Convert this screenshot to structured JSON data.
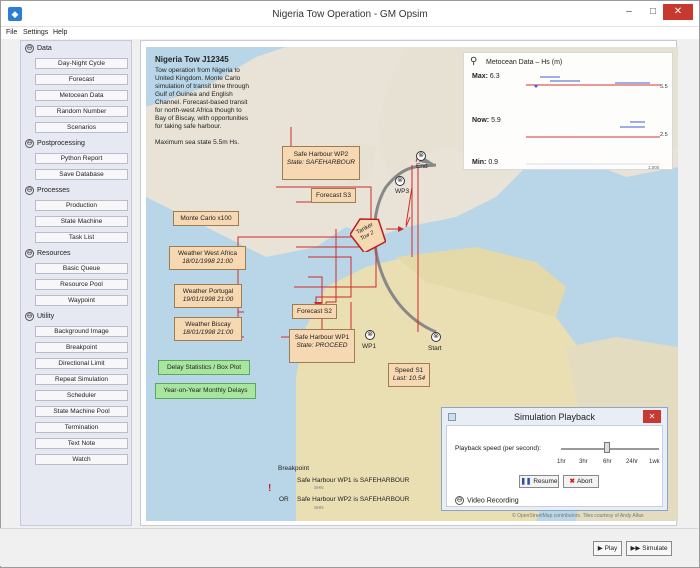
{
  "window": {
    "title": "Nigeria Tow Operation - GM Opsim",
    "app_icon": "app-icon",
    "min_symbol": "–",
    "max_symbol": "□",
    "close_symbol": "✕"
  },
  "menu": [
    "File",
    "Settings",
    "Help"
  ],
  "sidebar": {
    "sections": [
      {
        "label": "Data",
        "toggle": "⊖",
        "items": [
          "Day-Night Cycle",
          "Forecast",
          "Metocean Data",
          "Random Number",
          "Scenarios"
        ]
      },
      {
        "label": "Postprocessing",
        "toggle": "⊖",
        "items": [
          "Python Report",
          "Save Database"
        ]
      },
      {
        "label": "Processes",
        "toggle": "⊖",
        "items": [
          "Production",
          "State Machine",
          "Task List"
        ]
      },
      {
        "label": "Resources",
        "toggle": "⊖",
        "items": [
          "Basic Queue",
          "Resource Pool",
          "Waypoint"
        ]
      },
      {
        "label": "Utility",
        "toggle": "⊖",
        "items": [
          "Background Image",
          "Breakpoint",
          "Directional Limit",
          "Repeat Simulation",
          "Scheduler",
          "State Machine Pool",
          "Termination",
          "Text Note",
          "Watch"
        ]
      }
    ]
  },
  "info": {
    "title": "Nigeria Tow J12345",
    "description": "Tow operation from Nigeria to United Kingdom. Monte Carlo simulation of transit time through Gulf of Guinea and English Channel. Forecast-based transit for north-west Africa though to Bay of Biscay, with opportunities for taking safe harbour.",
    "max_sea_state": "Maximum sea state 5.5m Hs."
  },
  "boxes": {
    "safe_harbour_wp2": {
      "title": "Safe Harbour WP2",
      "status": "State: SAFEHARBOUR"
    },
    "forecast_s3": "Forecast S3",
    "monte_carlo": "Monte Carlo x100",
    "weather_west_africa": {
      "title": "Weather West Africa",
      "date": "18/01/1998 21:00"
    },
    "weather_portugal": {
      "title": "Weather Portugal",
      "date": "19/01/1998 21:00"
    },
    "weather_biscay": {
      "title": "Weather Biscay",
      "date": "18/01/1998 21:00"
    },
    "forecast_s2": "Forecast S2",
    "safe_harbour_wp1": {
      "title": "Safe Harbour WP1",
      "status": "State: PROCEED"
    },
    "speed_s1": {
      "title": "Speed S1",
      "last": "Last: 10.54"
    },
    "delay_stats": "Delay Statistics / Box Plot",
    "yoy_delays": "Year-on-Year Monthly Delays",
    "vessel": "Tanker",
    "vessel_sub": "Tow 2"
  },
  "waypoints": {
    "wp1": "WP1",
    "wp3": "WP3",
    "start": "Start",
    "end": "End"
  },
  "metocean": {
    "icon": "search-icon",
    "title": "Metocean Data – Hs (m)",
    "max_label": "Max:",
    "max_value": "6.3",
    "now_label": "Now:",
    "now_value": "5.9",
    "min_label": "Min:",
    "min_value": "0.9",
    "right_labels": [
      "5.5",
      "2.5"
    ],
    "axis_end": "1,000"
  },
  "playback": {
    "title": "Simulation Playback",
    "icon": "window-icon",
    "close": "✕",
    "speed_label": "Playback speed (per second):",
    "speed_ticks": [
      "1hr",
      "3hr",
      "6hr",
      "24hr",
      "1wk"
    ],
    "speed_fraction": 0.48,
    "resume": "Resume",
    "resume_icon": "❚❚",
    "abort": "Abort",
    "abort_icon": "✖",
    "video": "Video Recording",
    "video_toggle": "⊖"
  },
  "breakpoint": {
    "title": "Breakpoint",
    "row1_a": "Safe Harbour WP1",
    "row1_small": "SHN",
    "row1_b": "is SAFEHARBOUR",
    "or": "OR",
    "row2_a": "Safe Harbour WP2",
    "row2_small": "SHN",
    "row2_b": "is SAFEHARBOUR",
    "icon": "!"
  },
  "credits": "© OpenStreetMap contributors. Tiles courtesy of Andy Allan",
  "bottom": {
    "play": "Play",
    "play_icon": "▶",
    "simulate": "Simulate",
    "simulate_icon": "▶▶"
  }
}
